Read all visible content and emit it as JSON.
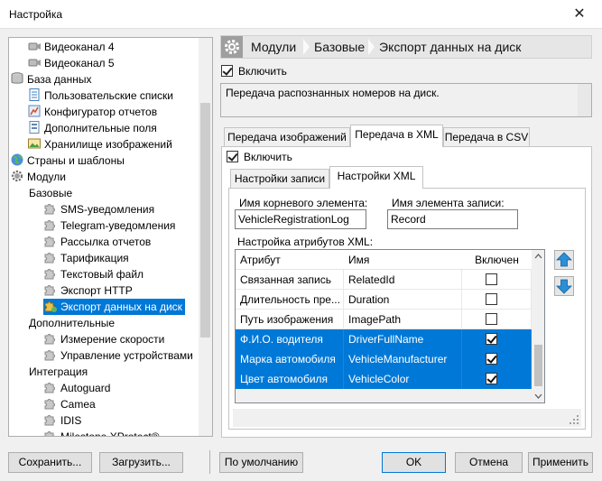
{
  "window": {
    "title": "Настройка",
    "close_glyph": "✕"
  },
  "tree": {
    "items": [
      {
        "label": "Видеоканал 4",
        "icon": "camera-icon"
      },
      {
        "label": "Видеоканал 5",
        "icon": "camera-icon"
      },
      {
        "label": "База данных",
        "icon": "database-icon"
      },
      {
        "label": "Пользовательские списки",
        "icon": "list-icon"
      },
      {
        "label": "Конфигуратор отчетов",
        "icon": "report-icon"
      },
      {
        "label": "Дополнительные поля",
        "icon": "fields-icon"
      },
      {
        "label": "Хранилище изображений",
        "icon": "image-storage-icon"
      },
      {
        "label": "Страны и шаблоны",
        "icon": "globe-icon"
      },
      {
        "label": "Модули",
        "icon": "gear-icon"
      },
      {
        "label": "Базовые",
        "icon": ""
      },
      {
        "label": "SMS-уведомления",
        "icon": "puzzle-icon"
      },
      {
        "label": "Telegram-уведомления",
        "icon": "puzzle-icon"
      },
      {
        "label": "Рассылка отчетов",
        "icon": "puzzle-icon"
      },
      {
        "label": "Тарификация",
        "icon": "puzzle-icon"
      },
      {
        "label": "Текстовый файл",
        "icon": "puzzle-icon"
      },
      {
        "label": "Экспорт HTTP",
        "icon": "puzzle-icon"
      },
      {
        "label": "Экспорт данных на диск",
        "icon": "puzzle-icon"
      },
      {
        "label": "Дополнительные",
        "icon": ""
      },
      {
        "label": "Измерение скорости",
        "icon": "puzzle-icon"
      },
      {
        "label": "Управление устройствами",
        "icon": "puzzle-icon"
      },
      {
        "label": "Интеграция",
        "icon": ""
      },
      {
        "label": "Autoguard",
        "icon": "puzzle-icon"
      },
      {
        "label": "Camea",
        "icon": "puzzle-icon"
      },
      {
        "label": "IDIS",
        "icon": "puzzle-icon"
      },
      {
        "label": "Milestone XProtect®",
        "icon": "puzzle-icon"
      }
    ]
  },
  "breadcrumb": {
    "items": [
      "Модули",
      "Базовые",
      "Экспорт данных на диск"
    ]
  },
  "enable_module": {
    "label": "Включить",
    "checked": true
  },
  "description": "Передача распознанных номеров на диск.",
  "outer_tabs": [
    "Передача изображений",
    "Передача в XML",
    "Передача в CSV"
  ],
  "xml_enable": {
    "label": "Включить",
    "checked": true
  },
  "inner_tabs": [
    "Настройки записи",
    "Настройки XML"
  ],
  "xml": {
    "root_label": "Имя корневого элемента:",
    "root_value": "VehicleRegistrationLog",
    "record_label": "Имя элемента записи:",
    "record_value": "Record",
    "attrs_label": "Настройка атрибутов XML:"
  },
  "grid": {
    "headers": [
      "Атрибут",
      "Имя",
      "Включен"
    ],
    "rows": [
      {
        "attr": "Связанная запись",
        "name": "RelatedId",
        "enabled": false,
        "selected": false
      },
      {
        "attr": "Длительность пре...",
        "name": "Duration",
        "enabled": false,
        "selected": false
      },
      {
        "attr": "Путь изображения",
        "name": "ImagePath",
        "enabled": false,
        "selected": false
      },
      {
        "attr": "Ф.И.О. водителя",
        "name": "DriverFullName",
        "enabled": true,
        "selected": true
      },
      {
        "attr": "Марка автомобиля",
        "name": "VehicleManufacturer",
        "enabled": true,
        "selected": true
      },
      {
        "attr": "Цвет автомобиля",
        "name": "VehicleColor",
        "enabled": true,
        "selected": true
      }
    ]
  },
  "buttons": {
    "save": "Сохранить...",
    "load": "Загрузить...",
    "defaults": "По умолчанию",
    "ok": "OK",
    "cancel": "Отмена",
    "apply": "Применить"
  },
  "colors": {
    "selection": "#0078d7",
    "arrow": "#2a8fd6"
  }
}
